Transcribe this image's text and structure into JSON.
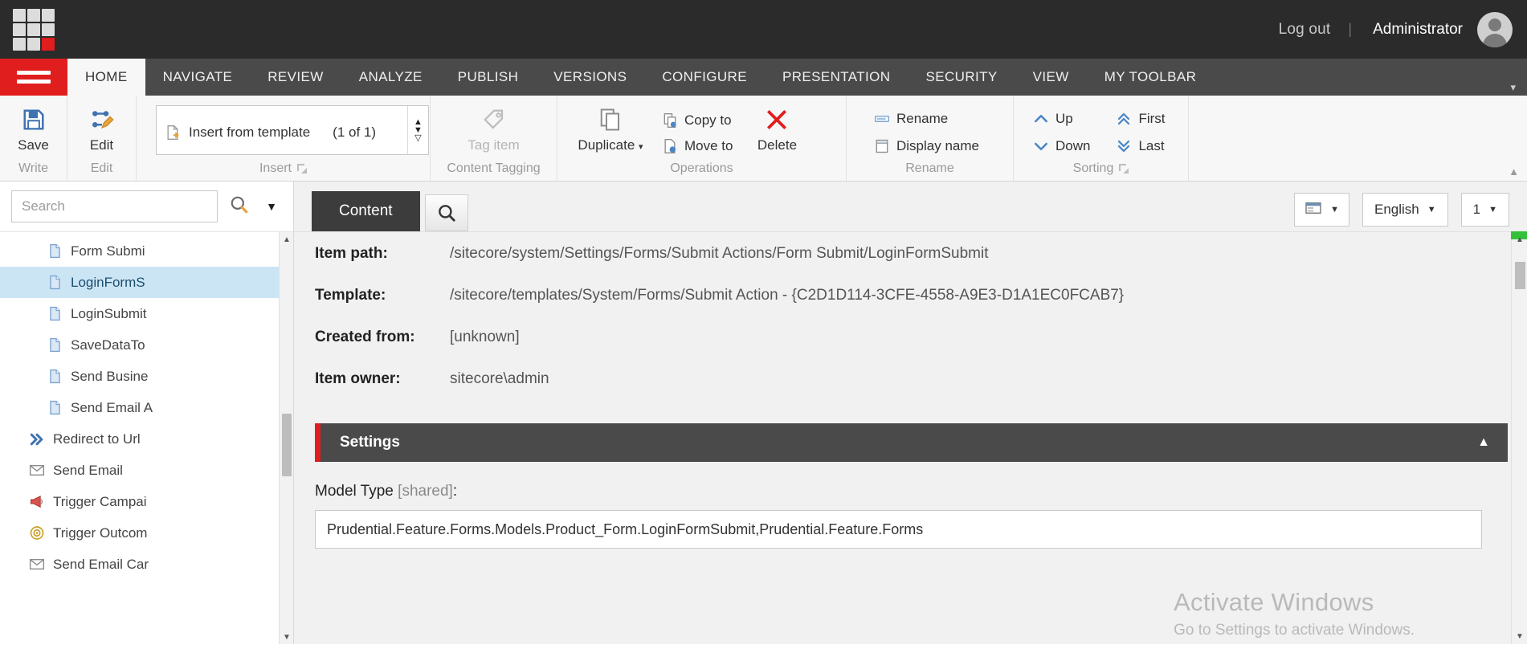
{
  "topbar": {
    "logout_label": "Log out",
    "separator": "|",
    "admin_label": "Administrator",
    "logo_name": "sitecore-logo"
  },
  "ribbon_tabs": [
    {
      "label": "HOME",
      "active": true
    },
    {
      "label": "NAVIGATE",
      "active": false
    },
    {
      "label": "REVIEW",
      "active": false
    },
    {
      "label": "ANALYZE",
      "active": false
    },
    {
      "label": "PUBLISH",
      "active": false
    },
    {
      "label": "VERSIONS",
      "active": false
    },
    {
      "label": "CONFIGURE",
      "active": false
    },
    {
      "label": "PRESENTATION",
      "active": false
    },
    {
      "label": "SECURITY",
      "active": false
    },
    {
      "label": "VIEW",
      "active": false
    },
    {
      "label": "MY TOOLBAR",
      "active": false
    }
  ],
  "ribbon": {
    "write_group": {
      "label": "Write",
      "save_label": "Save"
    },
    "edit_group": {
      "label": "Edit",
      "edit_label": "Edit"
    },
    "insert_group": {
      "label": "Insert",
      "insert_template_label": "Insert from template",
      "count_label": "(1 of 1)"
    },
    "tagging_group": {
      "label": "Content Tagging",
      "tag_item_label": "Tag item"
    },
    "operations_group": {
      "label": "Operations",
      "duplicate_label": "Duplicate",
      "copy_to_label": "Copy to",
      "move_to_label": "Move to",
      "delete_label": "Delete"
    },
    "rename_group": {
      "label": "Rename",
      "rename_label": "Rename",
      "display_name_label": "Display name"
    },
    "sorting_group": {
      "label": "Sorting",
      "up_label": "Up",
      "down_label": "Down",
      "first_label": "First",
      "last_label": "Last"
    }
  },
  "search": {
    "placeholder": "Search",
    "value": ""
  },
  "tree": {
    "items": [
      {
        "label": "Form Submi",
        "icon": "document-icon",
        "indent": 2,
        "selected": false
      },
      {
        "label": "LoginFormS",
        "icon": "document-icon",
        "indent": 2,
        "selected": true
      },
      {
        "label": "LoginSubmit",
        "icon": "document-icon",
        "indent": 2,
        "selected": false
      },
      {
        "label": "SaveDataTo",
        "icon": "document-icon",
        "indent": 2,
        "selected": false
      },
      {
        "label": "Send Busine",
        "icon": "document-icon",
        "indent": 2,
        "selected": false
      },
      {
        "label": "Send Email A",
        "icon": "document-icon",
        "indent": 2,
        "selected": false
      },
      {
        "label": "Redirect to Url",
        "icon": "double-chevron-icon",
        "indent": 1,
        "selected": false
      },
      {
        "label": "Send Email",
        "icon": "envelope-icon",
        "indent": 1,
        "selected": false
      },
      {
        "label": "Trigger Campai",
        "icon": "campaign-icon",
        "indent": 1,
        "selected": false
      },
      {
        "label": "Trigger Outcom",
        "icon": "outcome-icon",
        "indent": 1,
        "selected": false
      },
      {
        "label": "Send Email Car",
        "icon": "envelope-icon",
        "indent": 1,
        "selected": false
      }
    ]
  },
  "content_tabs": {
    "content_label": "Content",
    "search_icon": "search-icon",
    "view_selector_label": "",
    "language_label": "English",
    "version_label": "1"
  },
  "item_fields": [
    {
      "label": "Item path:",
      "value": "/sitecore/system/Settings/Forms/Submit Actions/Form Submit/LoginFormSubmit"
    },
    {
      "label": "Template:",
      "value": "/sitecore/templates/System/Forms/Submit Action - {C2D1D114-3CFE-4558-A9E3-D1A1EC0FCAB7}"
    },
    {
      "label": "Created from:",
      "value": "[unknown]"
    },
    {
      "label": "Item owner:",
      "value": "sitecore\\admin"
    }
  ],
  "settings_section": {
    "title": "Settings",
    "collapse_icon": "chevron-up-icon",
    "model_type_label": "Model Type",
    "model_type_shared": "[shared]",
    "model_type_colon": ":",
    "model_type_value": "Prudential.Feature.Forms.Models.Product_Form.LoginFormSubmit,Prudential.Feature.Forms"
  },
  "watermark": {
    "line1": "Activate Windows",
    "line2": "Go to Settings to activate Windows."
  },
  "colors": {
    "accent_red": "#e01e1e",
    "dark_bar": "#2b2b2b",
    "tab_bar": "#4a4a4a",
    "selected_tree": "#cbe5f5",
    "icon_blue": "#3f72b0"
  }
}
